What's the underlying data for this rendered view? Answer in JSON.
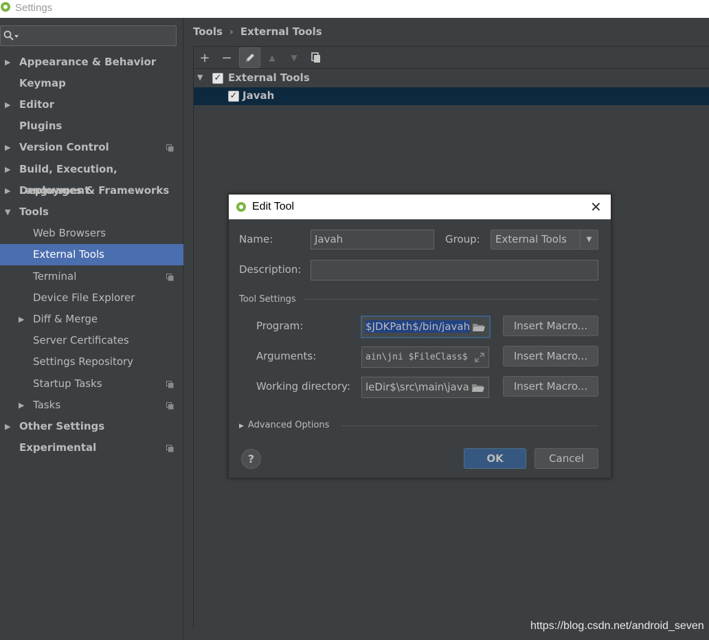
{
  "window": {
    "title": "Settings"
  },
  "search": {
    "placeholder": ""
  },
  "sidebar": {
    "items": [
      {
        "label": "Appearance & Behavior",
        "expandable": true,
        "bold": true
      },
      {
        "label": "Keymap",
        "expandable": false,
        "bold": true
      },
      {
        "label": "Editor",
        "expandable": true,
        "bold": true
      },
      {
        "label": "Plugins",
        "expandable": false,
        "bold": true
      },
      {
        "label": "Version Control",
        "expandable": true,
        "bold": true,
        "project_icon": true
      },
      {
        "label": "Build, Execution, Deployment",
        "expandable": true,
        "bold": true
      },
      {
        "label": "Languages & Frameworks",
        "expandable": true,
        "bold": true
      },
      {
        "label": "Tools",
        "expanded": true,
        "bold": true
      },
      {
        "label": "Web Browsers",
        "sub": true
      },
      {
        "label": "External Tools",
        "sub": true,
        "selected": true
      },
      {
        "label": "Terminal",
        "sub": true,
        "project_icon": true
      },
      {
        "label": "Device File Explorer",
        "sub": true
      },
      {
        "label": "Diff & Merge",
        "sub": true,
        "expandable": true
      },
      {
        "label": "Server Certificates",
        "sub": true
      },
      {
        "label": "Settings Repository",
        "sub": true
      },
      {
        "label": "Startup Tasks",
        "sub": true,
        "project_icon": true
      },
      {
        "label": "Tasks",
        "sub": true,
        "expandable": true,
        "project_icon": true
      },
      {
        "label": "Other Settings",
        "expandable": true,
        "bold": true
      },
      {
        "label": "Experimental",
        "bold": true,
        "project_icon": true
      }
    ]
  },
  "breadcrumb": {
    "parent": "Tools",
    "separator": "›",
    "current": "External Tools"
  },
  "toolbar": {
    "add": "+",
    "remove": "−",
    "edit_icon": "pencil-icon",
    "up": "▲",
    "down": "▼",
    "copy_icon": "copy-icon"
  },
  "tree": {
    "group": {
      "label": "External Tools",
      "checked": true,
      "arrow": "▼"
    },
    "tool": {
      "label": "Javah",
      "checked": true,
      "check": "✓"
    }
  },
  "dialog": {
    "title": "Edit Tool",
    "close": "✕",
    "name_label": "Name:",
    "name_value": "Javah",
    "group_label": "Group:",
    "group_value": "External Tools",
    "description_label": "Description:",
    "description_value": "",
    "tool_settings_label": "Tool Settings",
    "program_label": "Program:",
    "program_value": "$JDKPath$/bin/javah",
    "arguments_label": "Arguments:",
    "arguments_value": "ain\\jni $FileClass$",
    "workdir_label": "Working directory:",
    "workdir_value": "leDir$\\src\\main\\java",
    "insert_macro": "Insert Macro...",
    "advanced_label": "Advanced Options",
    "help": "?",
    "ok": "OK",
    "cancel": "Cancel"
  },
  "watermark": "https://blog.csdn.net/android_seven",
  "colors": {
    "selection": "#4b6eaf",
    "tree_selection": "#0d293e",
    "default_button": "#365880",
    "background": "#3c3f41"
  }
}
